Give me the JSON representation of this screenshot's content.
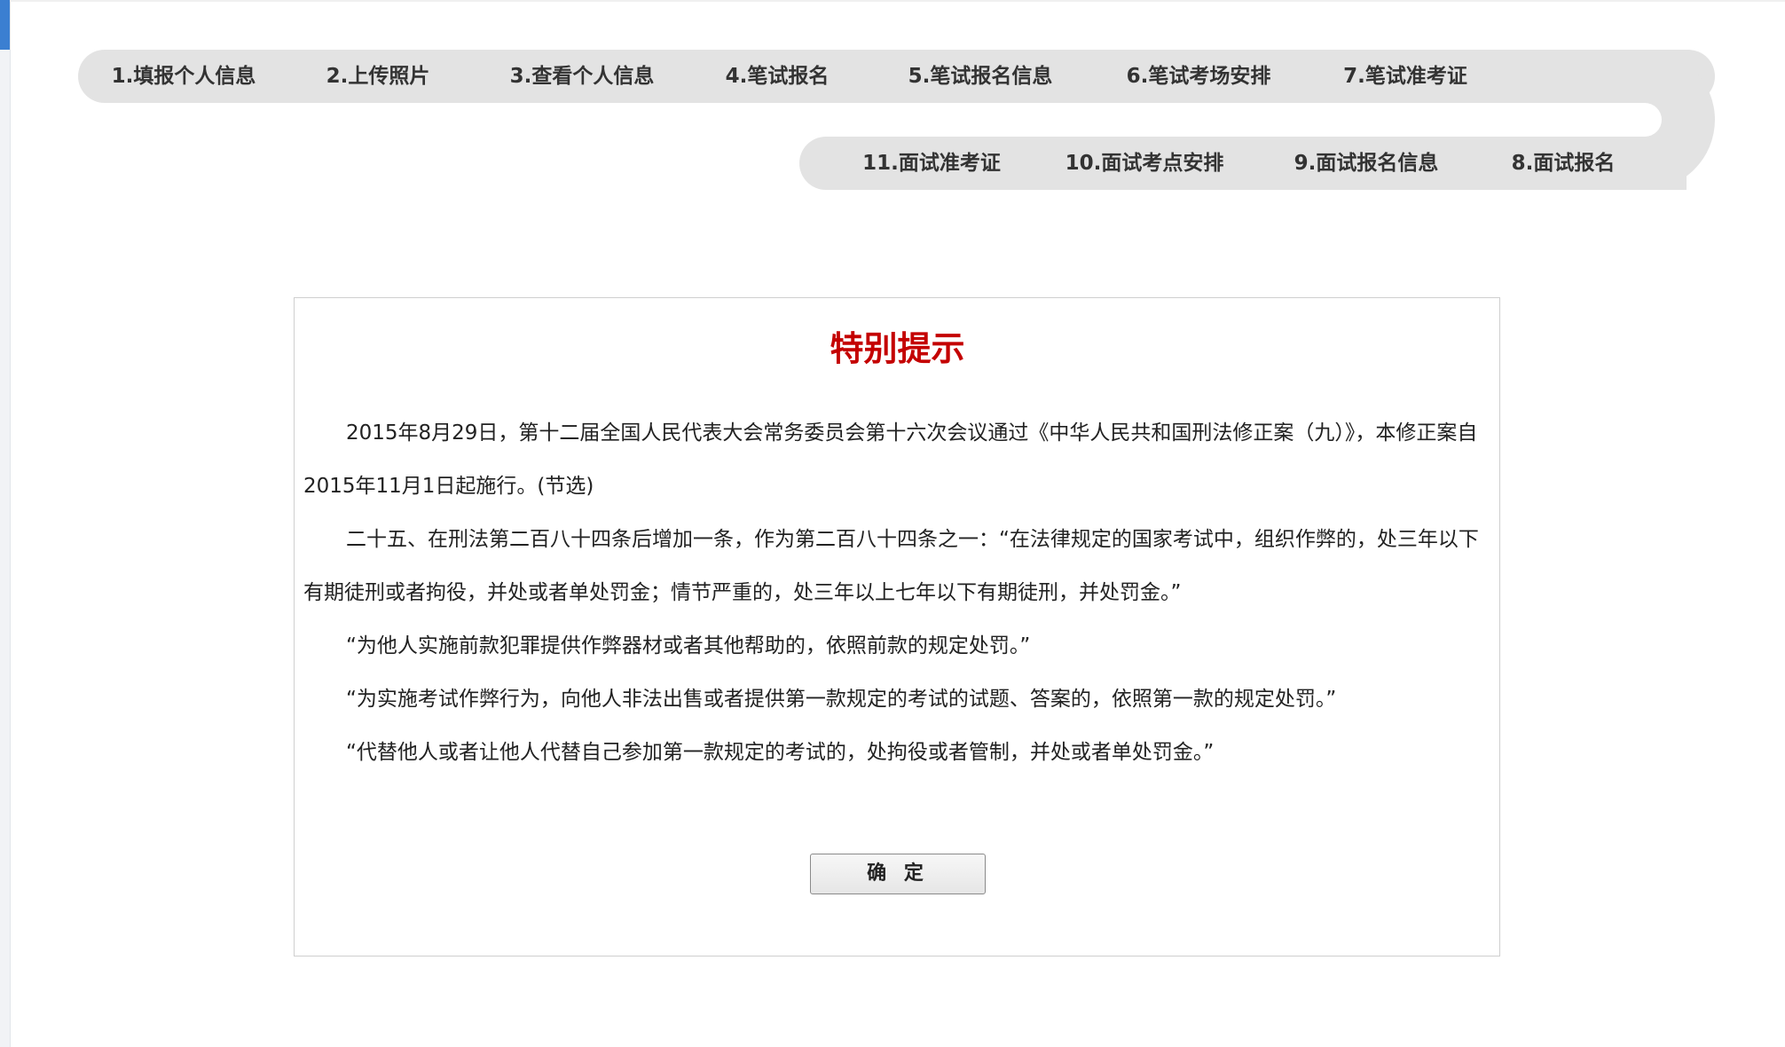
{
  "steps": {
    "s1": "1.填报个人信息",
    "s2": "2.上传照片",
    "s3": "3.查看个人信息",
    "s4": "4.笔试报名",
    "s5": "5.笔试报名信息",
    "s6": "6.笔试考场安排",
    "s7": "7.笔试准考证",
    "s8": "8.面试报名",
    "s9": "9.面试报名信息",
    "s10": "10.面试考点安排",
    "s11": "11.面试准考证"
  },
  "notice": {
    "title": "特别提示",
    "paragraphs": [
      "2015年8月29日，第十二届全国人民代表大会常务委员会第十六次会议通过《中华人民共和国刑法修正案（九）》，本修正案自2015年11月1日起施行。(节选)",
      "二十五、在刑法第二百八十四条后增加一条，作为第二百八十四条之一：“在法律规定的国家考试中，组织作弊的，处三年以下有期徒刑或者拘役，并处或者单处罚金；情节严重的，处三年以上七年以下有期徒刑，并处罚金。”",
      "“为他人实施前款犯罪提供作弊器材或者其他帮助的，依照前款的规定处罚。”",
      "“为实施考试作弊行为，向他人非法出售或者提供第一款规定的考试的试题、答案的，依照第一款的规定处罚。”",
      "“代替他人或者让他人代替自己参加第一款规定的考试的，处拘役或者管制，并处或者单处罚金。”"
    ],
    "confirm_label": "确 定"
  },
  "colors": {
    "title_red": "#c40000",
    "track_gray": "#e3e3e3",
    "accent_blue": "#3b7fd1"
  }
}
